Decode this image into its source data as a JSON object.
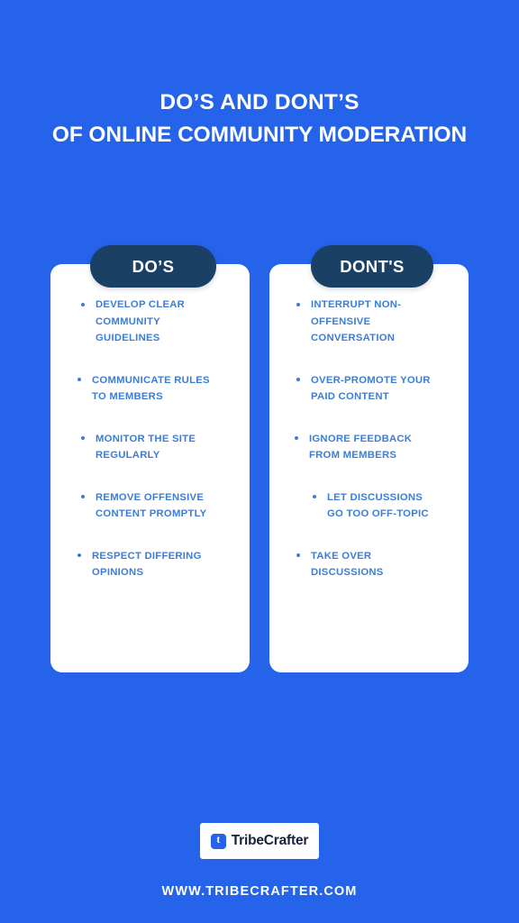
{
  "background_color": "#2563EB",
  "accent_navy": "#1A4065",
  "list_text_color": "#3B7DD8",
  "card_color": "#FFFFFF",
  "title": {
    "line1": "DO’S AND DONT’S",
    "line2": "OF ONLINE COMMUNITY MODERATION"
  },
  "columns": [
    {
      "heading": "DO’S",
      "items": [
        "DEVELOP CLEAR\nCOMMUNITY\nGUIDELINES",
        "COMMUNICATE RULES\nTO MEMBERS",
        "MONITOR THE SITE\nREGULARLY",
        "REMOVE OFFENSIVE\nCONTENT PROMPTLY",
        "RESPECT DIFFERING\nOPINIONS"
      ]
    },
    {
      "heading": "DONT'S",
      "items": [
        " INTERRUPT NON-\nOFFENSIVE\nCONVERSATION",
        "OVER-PROMOTE YOUR\nPAID CONTENT",
        "IGNORE FEEDBACK\nFROM MEMBERS",
        " LET DISCUSSIONS\nGO TOO OFF-TOPIC",
        " TAKE OVER\nDISCUSSIONS"
      ]
    }
  ],
  "footer": {
    "logo_mark_letter": "t",
    "logo_wordmark": "TribeCrafter",
    "url": "WWW.TRIBECRAFTER.COM"
  }
}
